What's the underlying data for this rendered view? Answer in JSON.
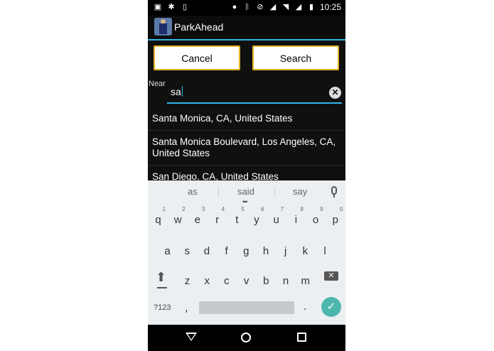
{
  "status_bar": {
    "time": "10:25",
    "left_icons": [
      "image-icon",
      "android-debug-icon",
      "phone-icon"
    ],
    "right_icons": [
      "location-icon",
      "bluetooth-icon",
      "no-disturb-icon",
      "signal-icon",
      "wifi-icon",
      "cell-signal-icon",
      "battery-icon"
    ]
  },
  "app_bar": {
    "title": "ParkAhead",
    "accent": "#33b5e5"
  },
  "buttons": {
    "cancel_label": "Cancel",
    "search_label": "Search",
    "border_color": "#e5b225"
  },
  "search": {
    "label": "Near",
    "value": "sa"
  },
  "suggestions": [
    "Santa Monica, CA, United States",
    "Santa Monica Boulevard, Los Angeles, CA, United States",
    "San Diego, CA, United States"
  ],
  "keyboard": {
    "word_suggestions": [
      "as",
      "said",
      "say"
    ],
    "row1": [
      {
        "ch": "q",
        "num": "1"
      },
      {
        "ch": "w",
        "num": "2"
      },
      {
        "ch": "e",
        "num": "3"
      },
      {
        "ch": "r",
        "num": "4"
      },
      {
        "ch": "t",
        "num": "5"
      },
      {
        "ch": "y",
        "num": "6"
      },
      {
        "ch": "u",
        "num": "7"
      },
      {
        "ch": "i",
        "num": "8"
      },
      {
        "ch": "o",
        "num": "9"
      },
      {
        "ch": "p",
        "num": "0"
      }
    ],
    "row2": [
      "a",
      "s",
      "d",
      "f",
      "g",
      "h",
      "j",
      "k",
      "l"
    ],
    "row3": [
      "z",
      "x",
      "c",
      "v",
      "b",
      "n",
      "m"
    ],
    "symbols_label": "?123",
    "comma": ",",
    "period": ".",
    "enter_color": "#4db6ac"
  },
  "nav_bar": {
    "icons": [
      "back-icon",
      "home-icon",
      "recents-icon"
    ]
  }
}
